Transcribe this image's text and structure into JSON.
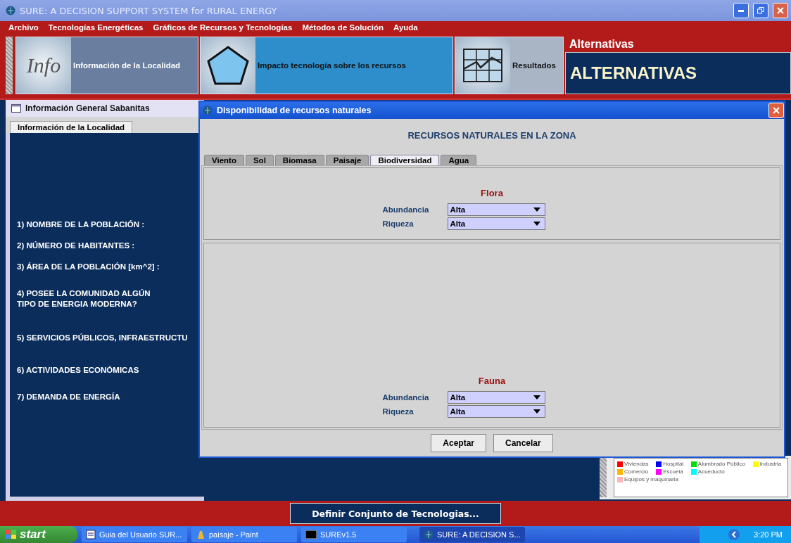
{
  "window": {
    "title": "SURE: A DECISION SUPPORT SYSTEM for RURAL ENERGY"
  },
  "menu": [
    "Archivo",
    "Tecnologías Energéticas",
    "Gráficos de Recursos y Tecnologías",
    "Métodos de Solución",
    "Ayuda"
  ],
  "toolbar": [
    {
      "kind": "info",
      "label": "Información de la Localidad",
      "icon_text": "Info"
    },
    {
      "kind": "impact",
      "label": "Impacto tecnología sobre los recursos"
    },
    {
      "kind": "results",
      "label": "Resultados"
    }
  ],
  "alternatives": {
    "label": "Alternativas",
    "value": "ALTERNATIVAS"
  },
  "left_frame": {
    "title": "Información General Sabanitas",
    "tabs": [
      {
        "label": "Información de la Localidad",
        "selected": true
      }
    ],
    "questions": [
      "1) NOMBRE DE LA POBLACIÓN :",
      "2) NÚMERO DE HABITANTES :",
      "3) ÁREA DE LA POBLACIÓN [km^2] :",
      "4) POSEE LA COMUNIDAD ALGÚN\nTIPO DE ENERGIA MODERNA?",
      "5) SERVICIOS PÚBLICOS, INFRAESTRUCTU",
      "6) ACTIVIDADES ECONÓMICAS",
      "7) DEMANDA DE ENERGÍA"
    ]
  },
  "dialog": {
    "title": "Disponibilidad de recursos naturales",
    "heading": "RECURSOS NATURALES EN LA ZONA",
    "tabs": [
      {
        "label": "Viento",
        "selected": false
      },
      {
        "label": "Sol",
        "selected": false
      },
      {
        "label": "Biomasa",
        "selected": false
      },
      {
        "label": "Paisaje",
        "selected": false
      },
      {
        "label": "Biodiversidad",
        "selected": true
      },
      {
        "label": "Agua",
        "selected": false
      }
    ],
    "sections": [
      {
        "title": "Flora",
        "fields": [
          {
            "label": "Abundancia",
            "value": "Alta"
          },
          {
            "label": "Riqueza",
            "value": "Alta"
          }
        ]
      },
      {
        "title": "Fauna",
        "fields": [
          {
            "label": "Abundancia",
            "value": "Alta"
          },
          {
            "label": "Riqueza",
            "value": "Alta"
          }
        ]
      }
    ],
    "buttons": [
      "Aceptar",
      "Cancelar"
    ]
  },
  "legend": [
    {
      "label": "Viviendas",
      "color": "#ff0000"
    },
    {
      "label": "Hospital",
      "color": "#0000ff"
    },
    {
      "label": "Alumbrado Público",
      "color": "#00dd00"
    },
    {
      "label": "Industria",
      "color": "#ffff00"
    },
    {
      "label": "Comercio",
      "color": "#ffb800"
    },
    {
      "label": "Escuela",
      "color": "#ff00ff"
    },
    {
      "label": "Acueducto",
      "color": "#00ffff"
    },
    {
      "label": "Equipos y maquinaria",
      "color": "#ffb6b6"
    }
  ],
  "define_button": "Definir Conjunto de Tecnologias...",
  "taskbar": {
    "start": "start",
    "tasks": [
      {
        "kind": "word",
        "label": "Guia del Usuario SUR...",
        "selected": false
      },
      {
        "kind": "paint",
        "label": "paisaje - Paint",
        "selected": false
      },
      {
        "kind": "console",
        "label": "SUREv1.5",
        "selected": false
      },
      {
        "kind": "app",
        "label": "SURE: A DECISION S...",
        "selected": true
      }
    ],
    "clock": "3:20 PM"
  }
}
